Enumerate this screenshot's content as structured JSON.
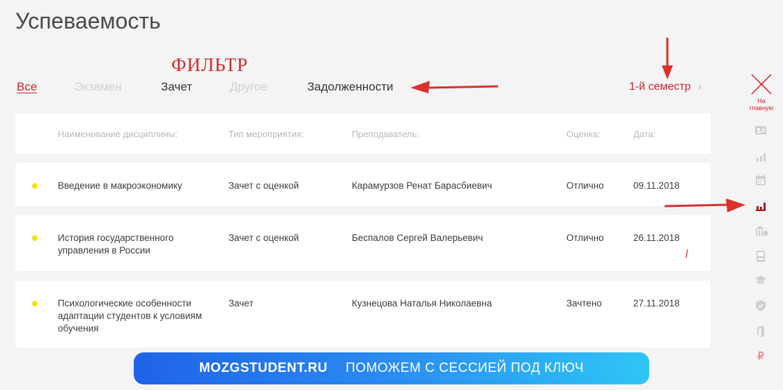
{
  "page": {
    "title": "Успеваемость"
  },
  "annotation": {
    "filter_note": "ФИЛЬТР"
  },
  "filters": [
    {
      "label": "Все",
      "state": "active"
    },
    {
      "label": "Экзамен",
      "state": "dim"
    },
    {
      "label": "Зачет",
      "state": "dark"
    },
    {
      "label": "Другое",
      "state": "dim"
    },
    {
      "label": "Задолженности",
      "state": "dark"
    }
  ],
  "semester": {
    "label": "1-й семестр",
    "chevron": "›"
  },
  "table": {
    "headers": {
      "name": "Наименование дисциплины:",
      "type": "Тип мероприятия:",
      "teacher": "Преподаватель:",
      "grade": "Оценка:",
      "date": "Дата:"
    },
    "rows": [
      {
        "name": "Введение в макроэкономику",
        "type": "Зачет с оценкой",
        "teacher": "Карамурзов Ренат Барасбиевич",
        "grade": "Отлично",
        "date": "09.11.2018"
      },
      {
        "name": "История государственного управления в России",
        "type": "Зачет с оценкой",
        "teacher": "Беспалов Сергей Валерьевич",
        "grade": "Отлично",
        "date": "26.11.2018"
      },
      {
        "name": "Психологические особенности адаптации студентов к условиям обучения",
        "type": "Зачет",
        "teacher": "Кузнецова Наталья Николаевна",
        "grade": "Зачтено",
        "date": "27.11.2018"
      }
    ]
  },
  "sidebar": {
    "home_label": "На главную",
    "icons": [
      "profile-card-icon",
      "stats-chart-icon",
      "calendar-icon",
      "performance-chart-icon",
      "university-icon",
      "book-icon",
      "graduation-cap-icon",
      "shield-icon",
      "office-icon",
      "ruble-icon"
    ],
    "active_icon": "performance-chart-icon"
  },
  "banner": {
    "brand": "MOZGSTUDENT.RU",
    "slogan": "ПОМОЖЕМ С СЕССИЕЙ ПОД КЛЮЧ"
  },
  "colors": {
    "accent": "#d0212b",
    "dot": "#f2e500",
    "muted": "#cfcfcf",
    "banner_start": "#1f63e8",
    "banner_end": "#2ec6f5"
  }
}
